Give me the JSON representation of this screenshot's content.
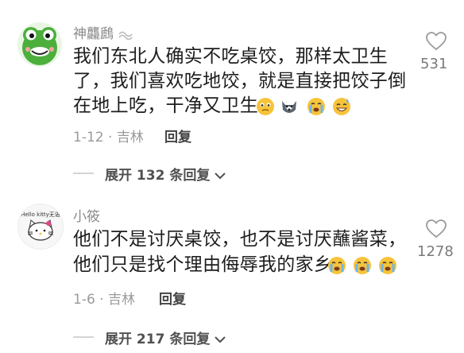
{
  "comments": [
    {
      "username": "神龘鷉",
      "lines": [
        "我们东北人确实不吃桌饺，那样太卫生",
        "了，我们喜欢吃地饺，就是直接把饺子倒",
        "在地上吃，干净又卫生"
      ],
      "date": "1-12",
      "location": "吉林",
      "reply_label": "回复",
      "likes": "531",
      "expand_label": "展开 132 条回复"
    },
    {
      "username": "小筱",
      "avatar_text": "Hello kitty无语",
      "lines": [
        "他们不是讨厌桌饺，也不是讨厌蘸酱菜，",
        "他们只是找个理由侮辱我的家乡"
      ],
      "date": "1-6",
      "location": "吉林",
      "reply_label": "回复",
      "likes": "1278",
      "expand_label": "展开 217 条回复"
    }
  ],
  "colors": {
    "frog_green": "#4caf3c",
    "emoji_yellow": "#f7c33a",
    "emoji_blue": "#6fb6e8"
  }
}
